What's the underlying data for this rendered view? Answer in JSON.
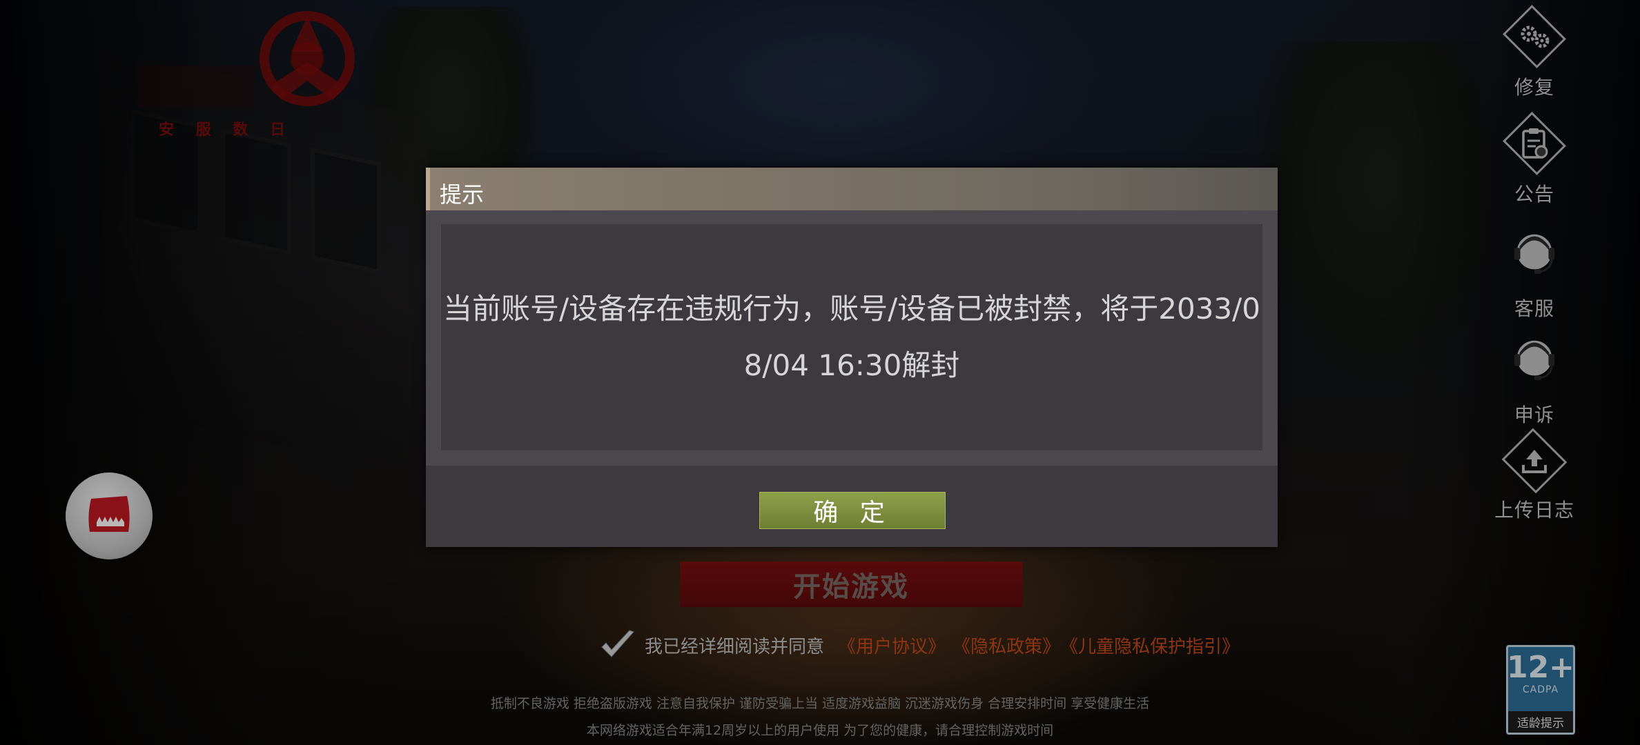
{
  "background": {
    "logo_text": "安 服 数 日"
  },
  "sidebar": {
    "items": [
      {
        "label": "修复",
        "icon": "gears-icon"
      },
      {
        "label": "公告",
        "icon": "clipboard-icon"
      },
      {
        "label": "客服",
        "icon": "headset-agent-icon"
      },
      {
        "label": "申诉",
        "icon": "headset-agent-icon"
      },
      {
        "label": "上传日志",
        "icon": "upload-icon"
      }
    ]
  },
  "floating_button": {
    "icon": "monster-mouth-icon"
  },
  "main": {
    "start_button": "开始游戏",
    "agreement": {
      "text": "我已经详细阅读并同意",
      "links": [
        "《用户协议》",
        "《隐私政策》",
        "《儿童隐私保护指引》"
      ]
    },
    "footer": {
      "line1": "抵制不良游戏 拒绝盗版游戏 注意自我保护 谨防受骗上当 适度游戏益脑 沉迷游戏伤身 合理安排时间 享受健康生活",
      "line2": "本网络游戏适合年满12周岁以上的用户使用   为了您的健康，请合理控制游戏时间"
    }
  },
  "age_rating": {
    "number": "12+",
    "org": "CADPA",
    "tip": "适龄提示"
  },
  "dialog": {
    "title": "提示",
    "message": "当前账号/设备存在违规行为，账号/设备已被封禁，将于2033/08/04 16:30解封",
    "confirm_label": "确 定"
  },
  "colors": {
    "dialog_bg": "#3c3a3e",
    "confirm_green": "#7e8f3f",
    "start_red": "#6e0d0d",
    "link_orange": "#c44a1a"
  }
}
